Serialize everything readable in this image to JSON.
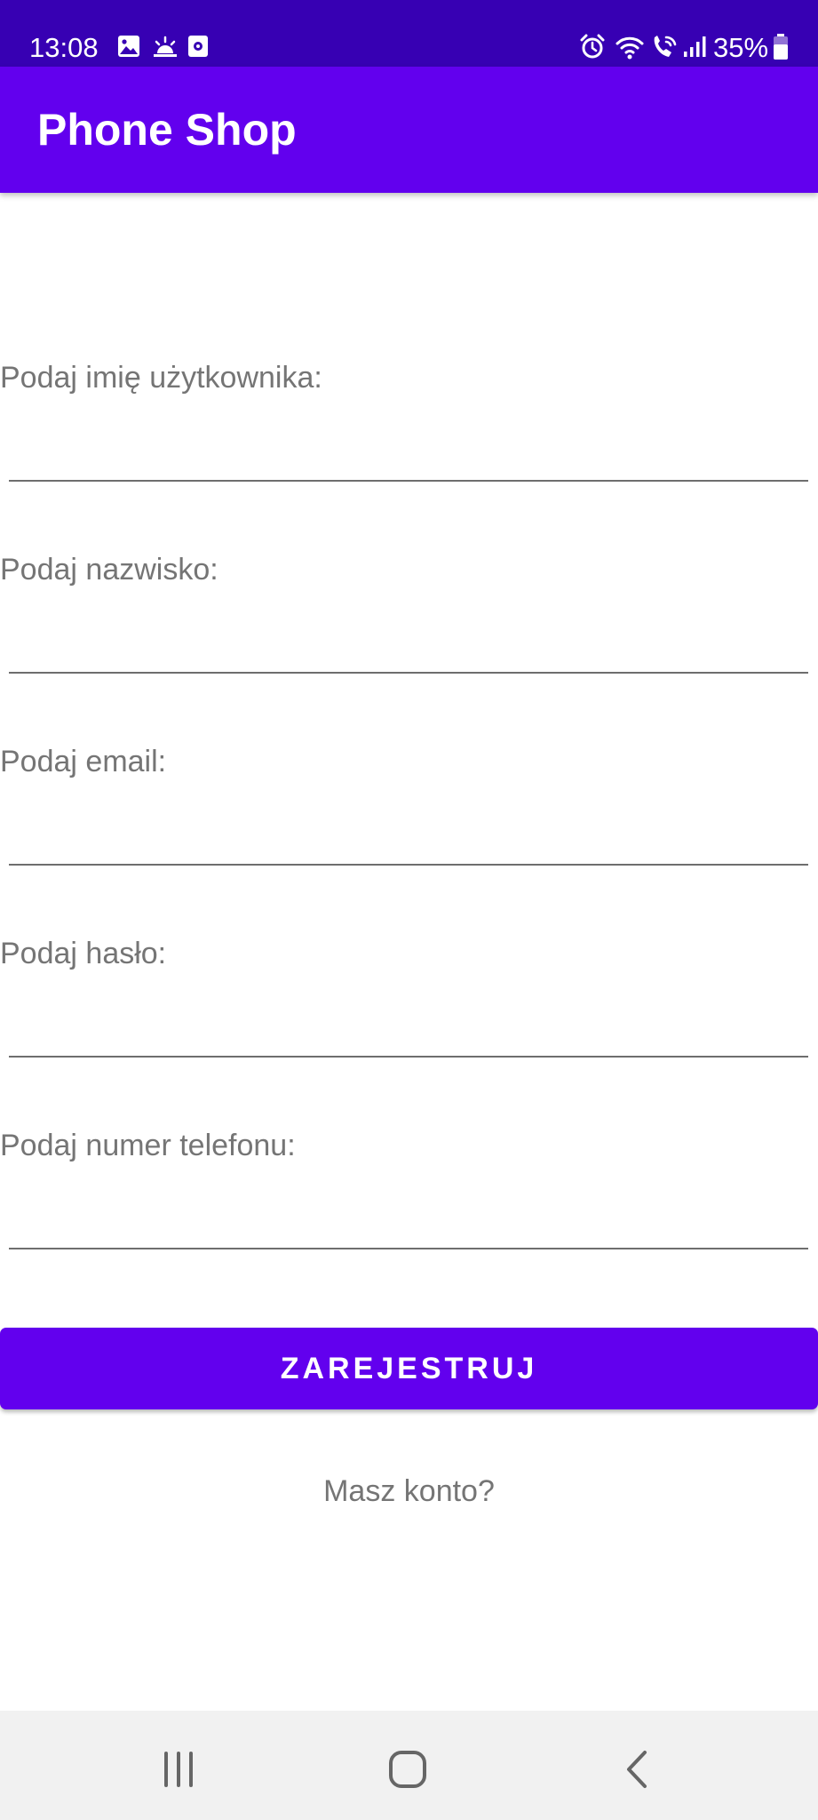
{
  "status_bar": {
    "time": "13:08",
    "left_icons": [
      "image-icon",
      "weather-icon",
      "screen-record-icon"
    ],
    "right_icons": [
      "alarm-icon",
      "wifi-icon",
      "wifi-calling-icon",
      "signal-icon"
    ],
    "battery": "35%"
  },
  "app_bar": {
    "title": "Phone Shop"
  },
  "form": {
    "fields": [
      {
        "label": "Podaj imię użytkownika:",
        "value": ""
      },
      {
        "label": "Podaj nazwisko:",
        "value": ""
      },
      {
        "label": "Podaj email:",
        "value": ""
      },
      {
        "label": "Podaj hasło:",
        "value": ""
      },
      {
        "label": "Podaj numer telefonu:",
        "value": ""
      }
    ],
    "submit_label": "ZAREJESTRUJ",
    "login_link": "Masz konto?"
  },
  "nav_bar": {
    "buttons": [
      "recent-apps-icon",
      "home-icon",
      "back-icon"
    ]
  },
  "colors": {
    "status_bar": "#3700b3",
    "primary": "#6200ee",
    "label_text": "#757575"
  }
}
